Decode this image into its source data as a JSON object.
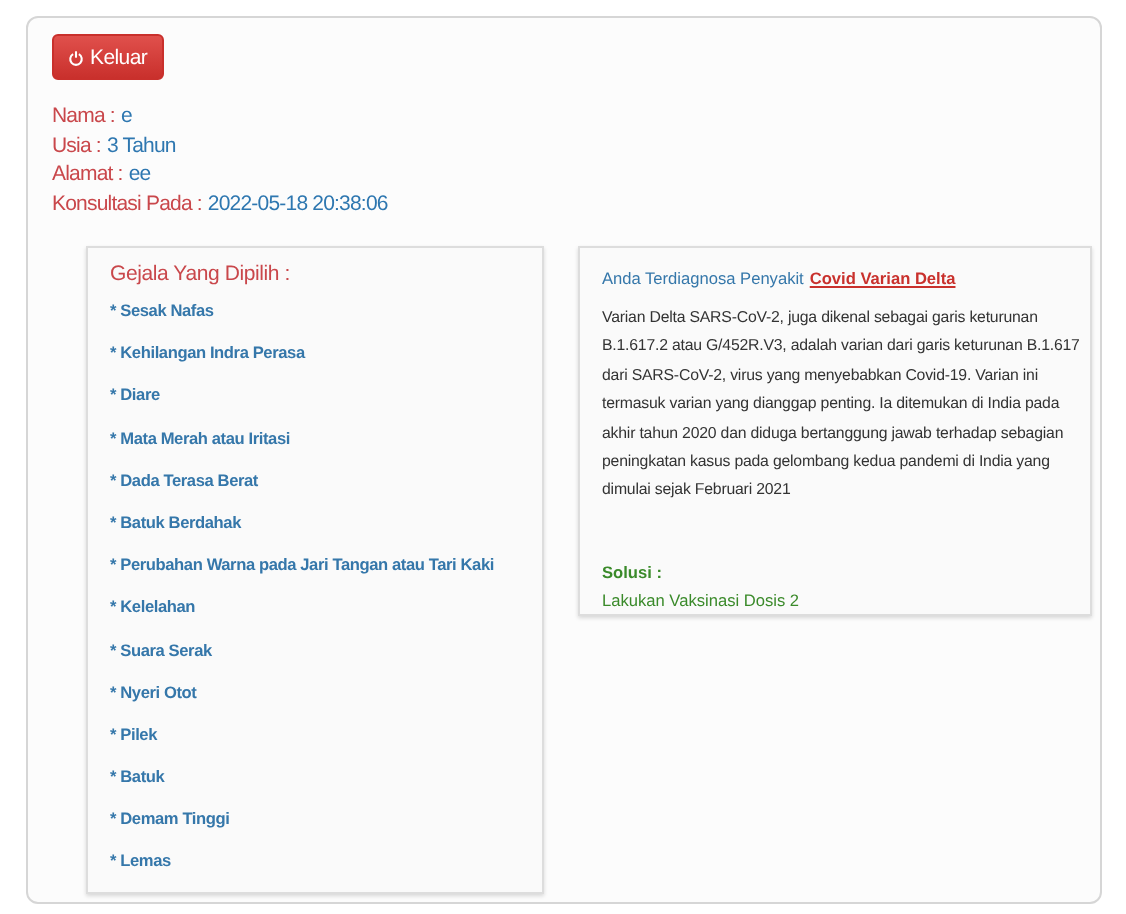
{
  "logout_button": {
    "label": "Keluar"
  },
  "patient": [
    {
      "label": "Nama :",
      "value": "e"
    },
    {
      "label": "Usia :",
      "value": "3 Tahun"
    },
    {
      "label": "Alamat :",
      "value": "ee"
    },
    {
      "label": "Konsultasi Pada :",
      "value": "2022-05-18 20:38:06"
    }
  ],
  "symptoms": {
    "title": "Gejala Yang Dipilih :",
    "items": [
      "* Sesak Nafas",
      "* Kehilangan Indra Perasa",
      "* Diare",
      "* Mata Merah atau Iritasi",
      "* Dada Terasa Berat",
      "* Batuk Berdahak",
      "* Perubahan Warna pada Jari Tangan atau Tari Kaki",
      "* Kelelahan",
      "* Suara Serak",
      "* Nyeri Otot",
      "* Pilek",
      "* Batuk",
      "* Demam Tinggi",
      "* Lemas"
    ]
  },
  "diagnosis": {
    "intro": "Anda Terdiagnosa Penyakit",
    "disease": "Covid Varian Delta",
    "description": "Varian Delta SARS-CoV-2, juga dikenal sebagai garis keturunan B.1.617.2 atau G/452R.V3, adalah varian dari garis keturunan B.1.617 dari SARS-CoV-2, virus yang menyebabkan Covid-19. Varian ini termasuk varian yang dianggap penting. Ia ditemukan di India pada akhir tahun 2020 dan diduga bertanggung jawab terhadap sebagian peningkatan kasus pada gelombang kedua pandemi di India yang dimulai sejak Februari 2021",
    "solution_label": "Solusi :",
    "solution": "Lakukan Vaksinasi Dosis 2"
  }
}
